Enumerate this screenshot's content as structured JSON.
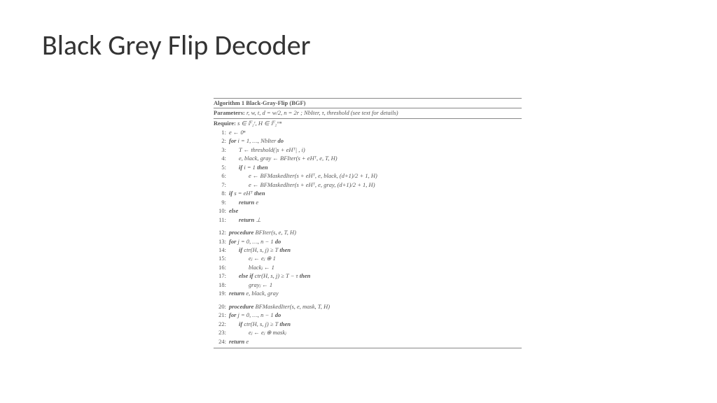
{
  "title": "Black Grey Flip Decoder",
  "algorithm": {
    "header": "Algorithm 1 Black-Gray-Flip (BGF)",
    "parameters_label": "Parameters:",
    "parameters": " r, w, t, d = w/2, n = 2r ; NbIter, τ, threshold (see text for details)",
    "require_label": "Require:",
    "require": " s ∈ 𝔽₂ʳ, H ∈ 𝔽₂ʳˣⁿ",
    "lines": [
      {
        "n": "1:",
        "indent": 0,
        "text": "e ← 0ⁿ"
      },
      {
        "n": "2:",
        "indent": 0,
        "text": "for i = 1, …, NbIter do",
        "bold": [
          "for",
          "do"
        ]
      },
      {
        "n": "3:",
        "indent": 1,
        "text": "T ← threshold(|s + eHᵀ| , i)"
      },
      {
        "n": "4:",
        "indent": 1,
        "text": "e, black, gray ← BFIter(s + eHᵀ, e, T, H)"
      },
      {
        "n": "5:",
        "indent": 1,
        "text": "if i = 1 then",
        "bold": [
          "if",
          "then"
        ]
      },
      {
        "n": "6:",
        "indent": 2,
        "text": "e ← BFMaskedIter(s + eHᵀ, e, black, (d+1)/2 + 1, H)"
      },
      {
        "n": "7:",
        "indent": 2,
        "text": "e ← BFMaskedIter(s + eHᵀ, e, gray, (d+1)/2 + 1, H)"
      },
      {
        "n": "8:",
        "indent": 0,
        "text": "if s = eHᵀ then",
        "bold": [
          "if",
          "then"
        ]
      },
      {
        "n": "9:",
        "indent": 1,
        "text": "return e",
        "bold": [
          "return"
        ]
      },
      {
        "n": "10:",
        "indent": 0,
        "text": "else",
        "bold": [
          "else"
        ]
      },
      {
        "n": "11:",
        "indent": 1,
        "text": "return ⊥",
        "bold": [
          "return"
        ]
      }
    ],
    "proc1_lines": [
      {
        "n": "12:",
        "indent": 0,
        "text": "procedure BFIter(s, e, T, H)",
        "bold": [
          "procedure"
        ]
      },
      {
        "n": "13:",
        "indent": 0,
        "text": "for j = 0, …, n − 1 do",
        "bold": [
          "for",
          "do"
        ]
      },
      {
        "n": "14:",
        "indent": 1,
        "text": "if ctr(H, s, j) ≥ T then",
        "bold": [
          "if",
          "then"
        ]
      },
      {
        "n": "15:",
        "indent": 2,
        "text": "eⱼ ← eⱼ ⊕ 1"
      },
      {
        "n": "16:",
        "indent": 2,
        "text": "blackⱼ ← 1"
      },
      {
        "n": "17:",
        "indent": 1,
        "text": "else if ctr(H, s, j) ≥ T − τ then",
        "bold": [
          "else if",
          "then"
        ]
      },
      {
        "n": "18:",
        "indent": 2,
        "text": "grayⱼ ← 1"
      },
      {
        "n": "19:",
        "indent": 0,
        "text": "return e, black, gray",
        "bold": [
          "return"
        ]
      }
    ],
    "proc2_lines": [
      {
        "n": "20:",
        "indent": 0,
        "text": "procedure BFMaskedIter(s, e, mask, T, H)",
        "bold": [
          "procedure"
        ]
      },
      {
        "n": "21:",
        "indent": 0,
        "text": "for j = 0, …, n − 1 do",
        "bold": [
          "for",
          "do"
        ]
      },
      {
        "n": "22:",
        "indent": 1,
        "text": "if ctr(H, s, j) ≥ T then",
        "bold": [
          "if",
          "then"
        ]
      },
      {
        "n": "23:",
        "indent": 2,
        "text": "eⱼ ← eⱼ ⊕ maskⱼ"
      },
      {
        "n": "24:",
        "indent": 0,
        "text": "return e",
        "bold": [
          "return"
        ]
      }
    ]
  }
}
